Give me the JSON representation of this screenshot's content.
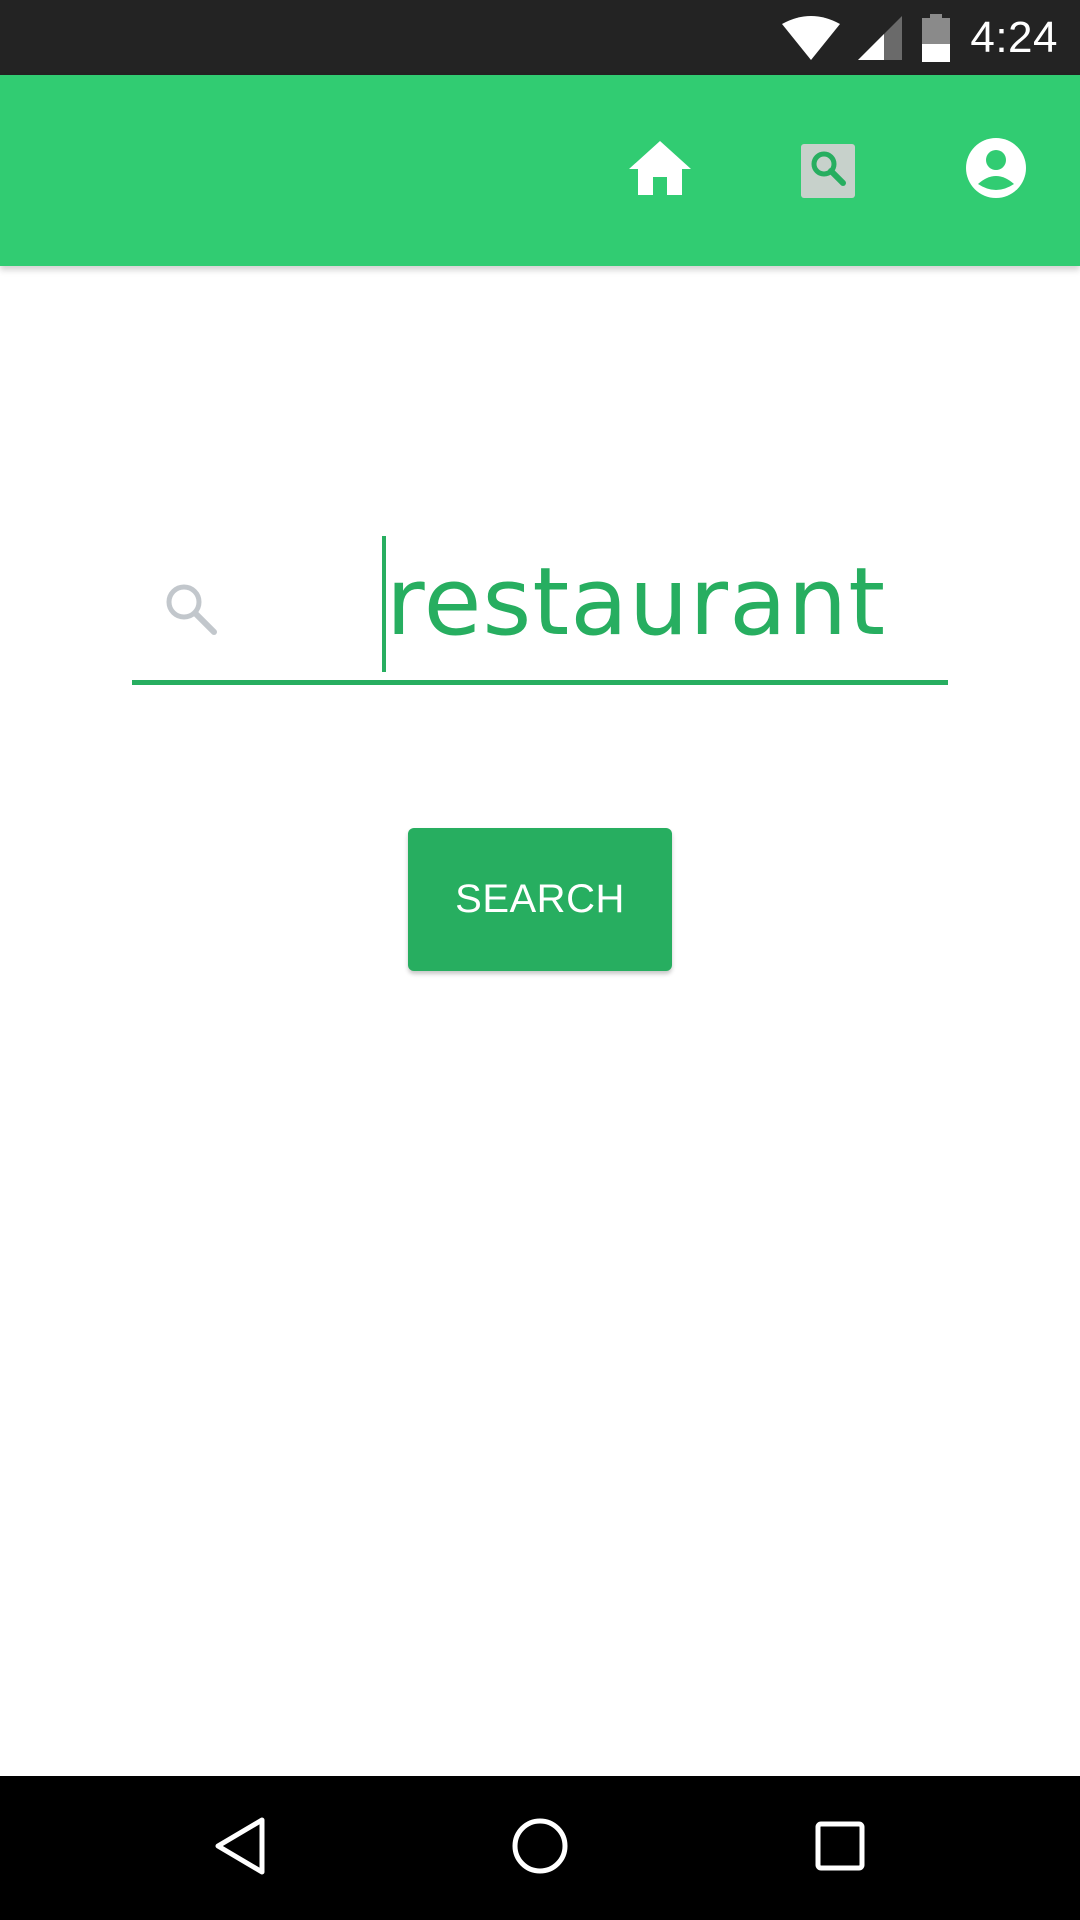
{
  "status_bar": {
    "time": "4:24",
    "icons": [
      "wifi-icon",
      "cell-signal-icon",
      "battery-icon"
    ]
  },
  "app_bar": {
    "color": "#31cc72",
    "nav_items": [
      {
        "name": "home",
        "icon": "home-icon"
      },
      {
        "name": "search",
        "icon": "search-icon",
        "selected": true
      },
      {
        "name": "profile",
        "icon": "account-circle-icon"
      }
    ]
  },
  "search": {
    "value": "restaurant",
    "icon": "search-icon",
    "accent": "#27ae60"
  },
  "search_button": {
    "label": "SEARCH"
  },
  "system_nav": {
    "buttons": [
      "back-icon",
      "home-circle-icon",
      "recents-icon"
    ]
  }
}
